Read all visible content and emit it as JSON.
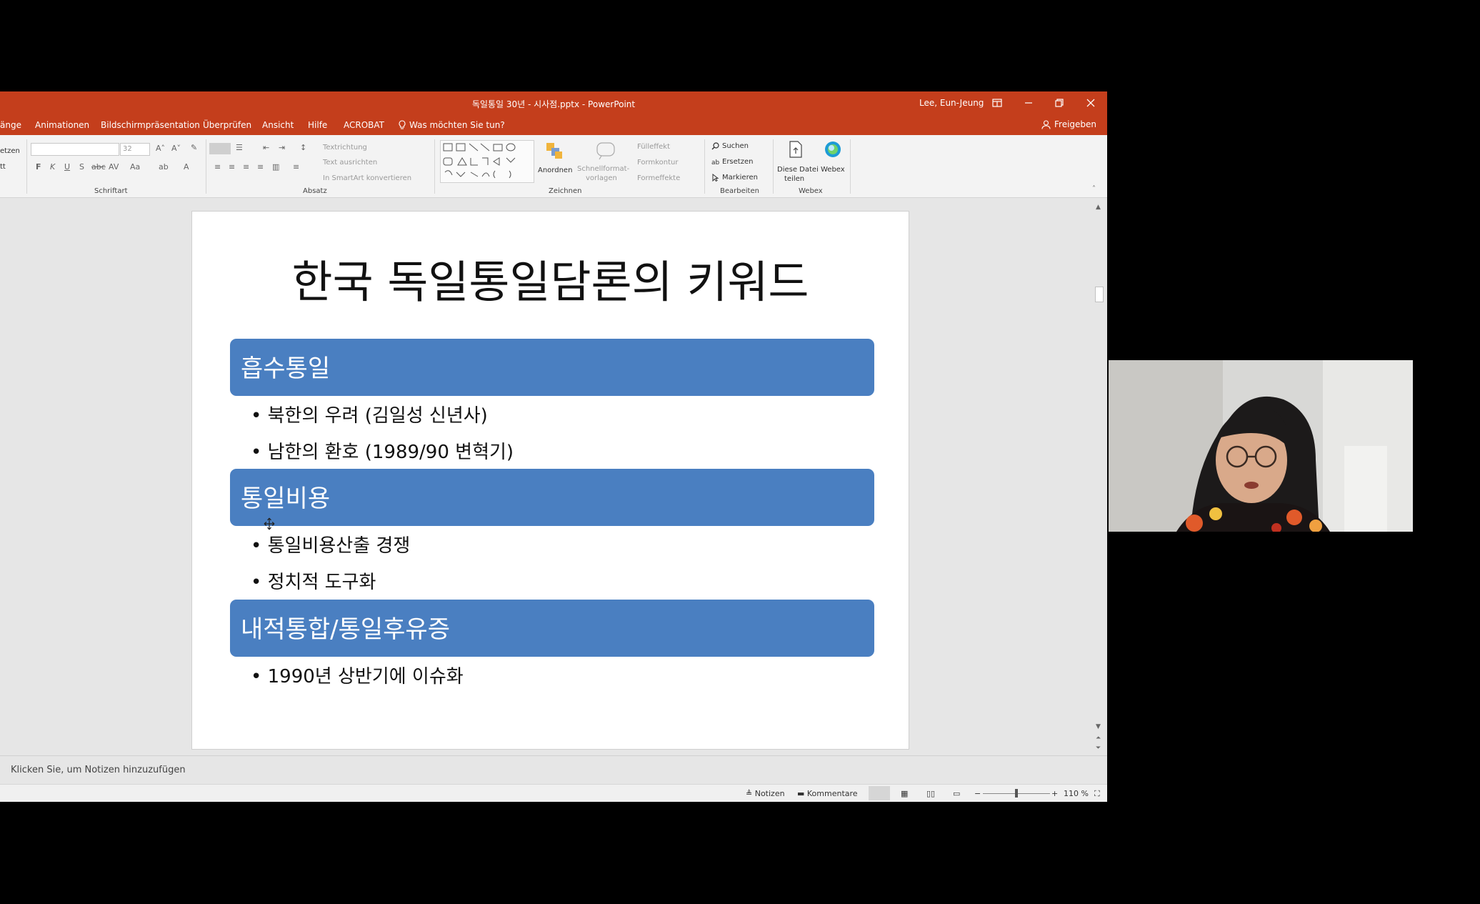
{
  "titlebar": {
    "document_title": "독일통일 30년 - 시사점.pptx  -  PowerPoint",
    "user": "Lee, Eun-Jeung"
  },
  "tabs": [
    {
      "label": "änge"
    },
    {
      "label": "Animationen"
    },
    {
      "label": "Bildschirmpräsentation"
    },
    {
      "label": "Überprüfen"
    },
    {
      "label": "Ansicht"
    },
    {
      "label": "Hilfe"
    },
    {
      "label": "ACROBAT"
    },
    {
      "label": "Was möchten Sie tun?"
    }
  ],
  "share_label": "Freigeben",
  "ribbon": {
    "clipboard_partial": [
      "etzen",
      "tt"
    ],
    "font_size_value": "32",
    "groups": {
      "font": "Schriftart",
      "paragraph": "Absatz",
      "drawing": "Zeichnen",
      "editing": "Bearbeiten",
      "webex": "Webex"
    },
    "paragraph_items": [
      "Textrichtung",
      "Text ausrichten",
      "In SmartArt konvertieren"
    ],
    "arrange_label": "Anordnen",
    "quick_styles_label": [
      "Schnellformat-",
      "vorlagen"
    ],
    "shape_items": [
      "Fülleffekt",
      "Formkontur",
      "Formeffekte"
    ],
    "editing_items": [
      "Suchen",
      "Ersetzen",
      "Markieren"
    ],
    "share_file_label": [
      "Diese Datei",
      "teilen"
    ],
    "webex_label": "Webex"
  },
  "slide": {
    "title": "한국 독일통일담론의 키워드",
    "sections": [
      {
        "heading": "흡수통일",
        "bullets": [
          "북한의 우려 (김일성 신년사)",
          "남한의 환호 (1989/90 변혁기)"
        ]
      },
      {
        "heading": "통일비용",
        "bullets": [
          "통일비용산출 경쟁",
          "정치적 도구화"
        ]
      },
      {
        "heading": "내적통합/통일후유증",
        "bullets": [
          "1990년 상반기에 이슈화"
        ]
      }
    ]
  },
  "notes_placeholder": "Klicken Sie, um Notizen hinzuzufügen",
  "status": {
    "notes": "Notizen",
    "comments": "Kommentare",
    "zoom": "110 %"
  },
  "colors": {
    "brand": "#c43e1c",
    "section_bar": "#4a7fc1"
  }
}
